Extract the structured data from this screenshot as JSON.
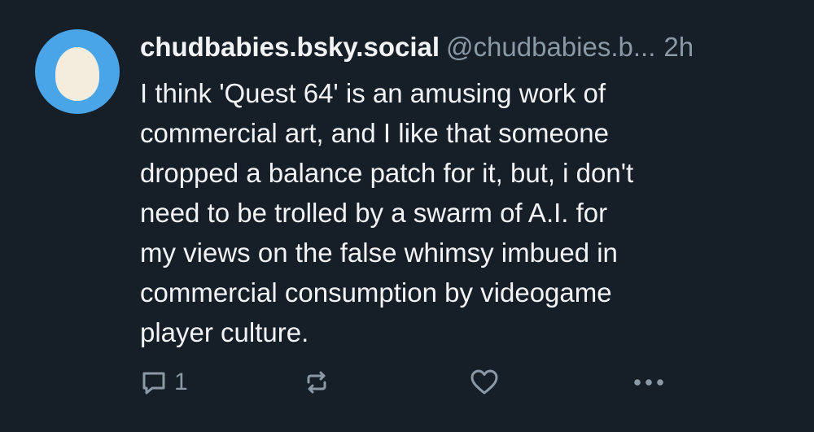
{
  "post": {
    "author": {
      "display_name": "chudbabies.bsky.social",
      "handle": "@chudbabies.b...",
      "avatar_icon": "egg-avatar-icon"
    },
    "timestamp": "2h",
    "text": "I think 'Quest 64' is an amusing work of\ncommercial art, and I like that someone\ndropped a balance patch for it, but, i don't\nneed to be trolled by a swarm of A.I. for\nmy views on the false whimsy imbued in\ncommercial consumption by videogame\nplayer culture.",
    "actions": {
      "reply_count": "1",
      "reply_icon": "reply-icon",
      "repost_icon": "repost-icon",
      "like_icon": "heart-icon",
      "more_icon": "more-options-icon"
    }
  },
  "colors": {
    "background": "#161e27",
    "text": "#f1f3f5",
    "muted": "#8b98a5",
    "avatar": "#4aa5e8",
    "egg": "#f4ecdc"
  }
}
